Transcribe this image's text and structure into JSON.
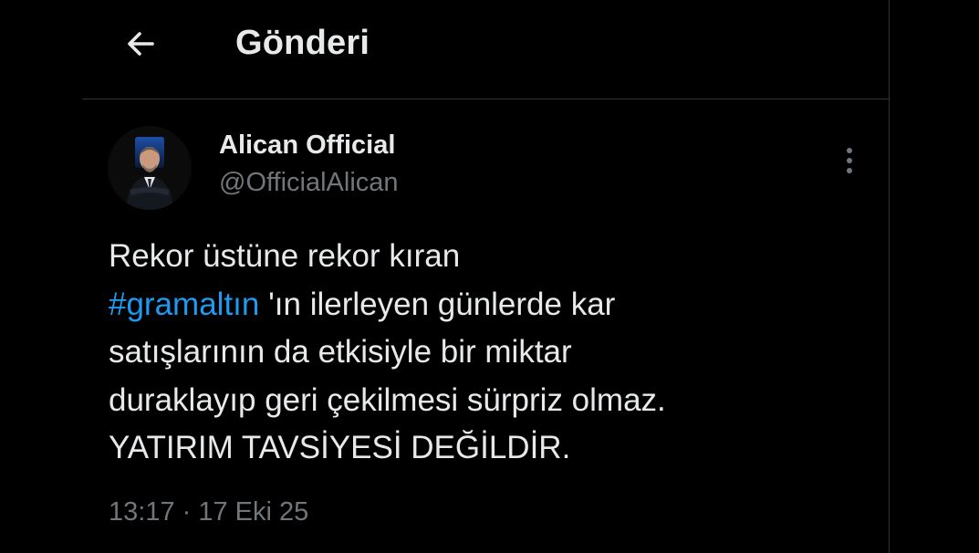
{
  "header": {
    "title": "Gönderi",
    "back_icon": "arrow-left-icon"
  },
  "tweet": {
    "author": {
      "name": "Alican Official",
      "handle": "@OfficialAlican",
      "avatar_icon": "profile-photo"
    },
    "more_icon": "more-vertical-icon",
    "text": {
      "line1": "Rekor üstüne rekor kıran",
      "hashtag": "#gramaltın",
      "line2_rest": " 'ın ilerleyen günlerde kar",
      "line3": "satışlarının da etkisiyle bir miktar",
      "line4": "duraklayıp geri çekilmesi sürpriz olmaz.",
      "line5": "YATIRIM TAVSİYESİ DEĞİLDİR."
    },
    "timestamp": "13:17 · 17 Eki 25"
  },
  "colors": {
    "background": "#000000",
    "text": "#e7e9ea",
    "secondary": "#71767b",
    "accent": "#1d9bf0",
    "border": "#2f3336"
  }
}
